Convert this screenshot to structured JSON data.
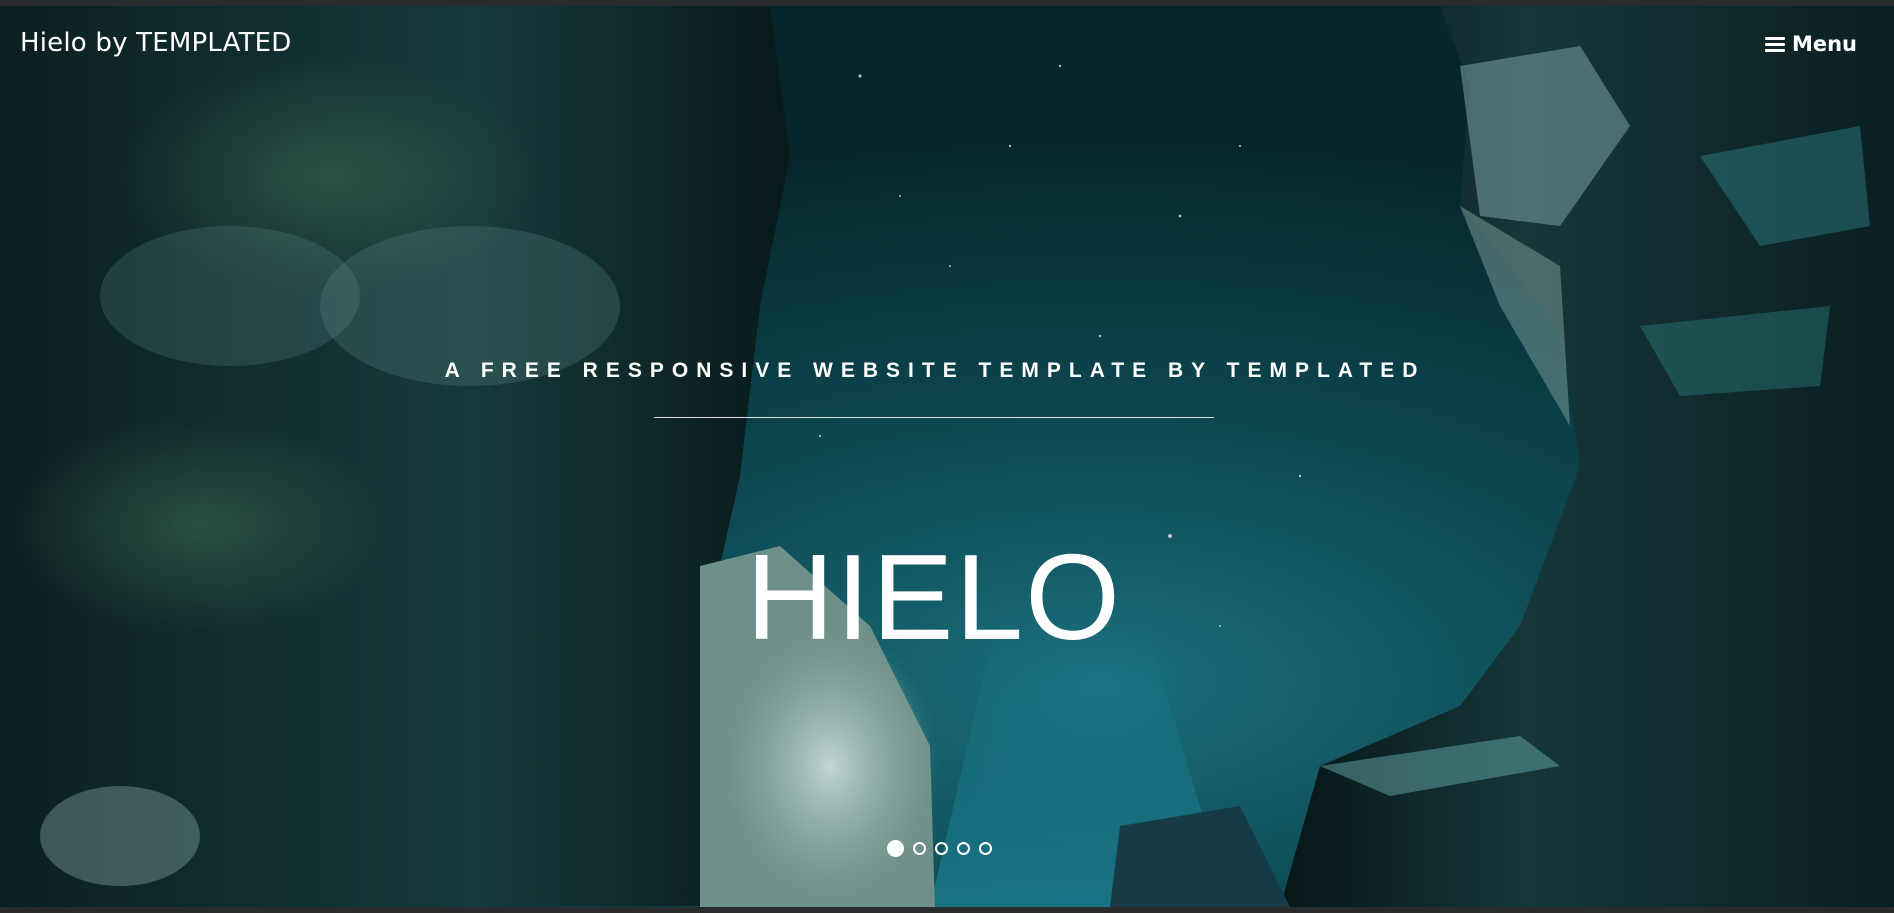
{
  "header": {
    "brand": "Hielo by TEMPLATED",
    "menu_label": "Menu",
    "menu_icon": "hamburger-icon"
  },
  "hero": {
    "tagline": "A FREE RESPONSIVE WEBSITE TEMPLATE BY TEMPLATED",
    "headline": "HIELO",
    "slides_total": 5,
    "slide_active": 1
  },
  "colors": {
    "sky": "#0b4a52",
    "rock": "#0e2a2c",
    "ice": "#a9c9c8",
    "text": "#ffffff"
  }
}
